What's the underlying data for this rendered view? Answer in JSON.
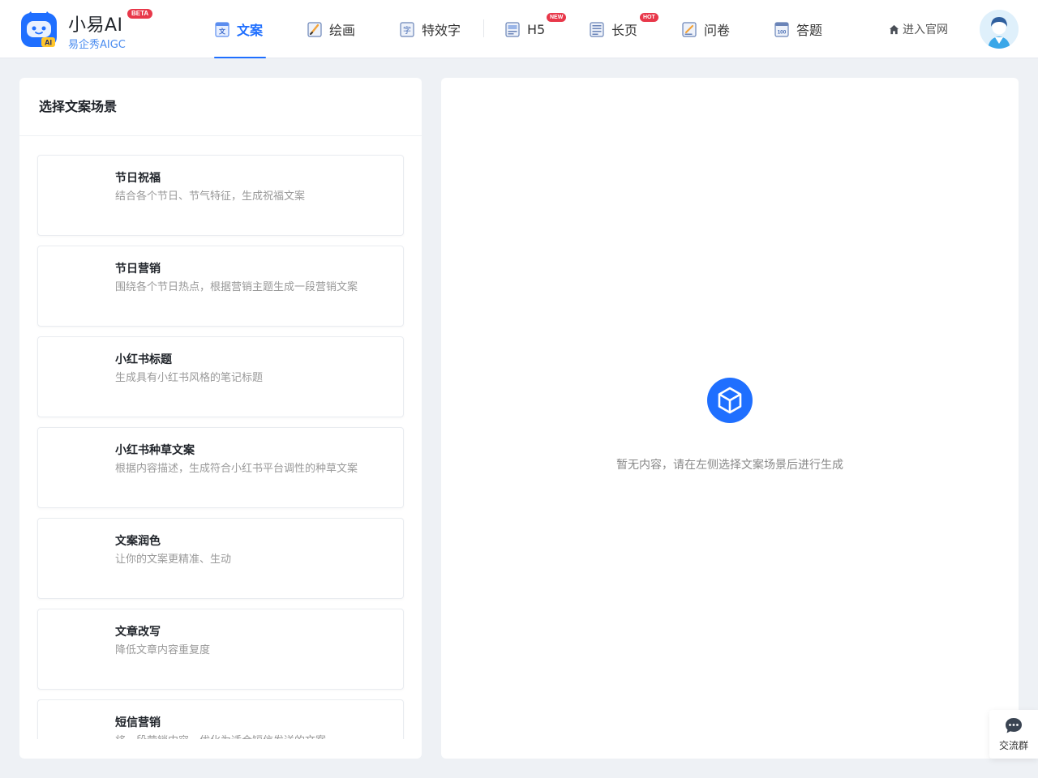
{
  "header": {
    "brand_name": "小易AI",
    "brand_badge": "BETA",
    "brand_sub": "易企秀AIGC",
    "nav": [
      {
        "label": "文案",
        "icon": "copywriting-icon",
        "active": true
      },
      {
        "label": "绘画",
        "icon": "painting-icon",
        "active": false
      },
      {
        "label": "特效字",
        "icon": "effect-text-icon",
        "active": false
      },
      {
        "label": "H5",
        "icon": "h5-icon",
        "active": false,
        "badge": "NEW"
      },
      {
        "label": "长页",
        "icon": "long-page-icon",
        "active": false,
        "badge": "HOT"
      },
      {
        "label": "问卷",
        "icon": "survey-icon",
        "active": false
      },
      {
        "label": "答题",
        "icon": "quiz-icon",
        "active": false
      }
    ],
    "official_link": "进入官网"
  },
  "left_panel": {
    "title": "选择文案场景",
    "scenes": [
      {
        "title": "节日祝福",
        "desc": "结合各个节日、节气特征，生成祝福文案"
      },
      {
        "title": "节日营销",
        "desc": "围绕各个节日热点，根据营销主题生成一段营销文案"
      },
      {
        "title": "小红书标题",
        "desc": "生成具有小红书风格的笔记标题"
      },
      {
        "title": "小红书种草文案",
        "desc": "根据内容描述，生成符合小红书平台调性的种草文案"
      },
      {
        "title": "文案润色",
        "desc": "让你的文案更精准、生动"
      },
      {
        "title": "文章改写",
        "desc": "降低文章内容重复度"
      },
      {
        "title": "短信营销",
        "desc": "将一段营销内容，优化为适合短信发送的文案"
      }
    ]
  },
  "right_panel": {
    "empty_text": "暂无内容，请在左侧选择文案场景后进行生成",
    "empty_icon": "box-icon"
  },
  "float_button": {
    "label": "交流群",
    "icon": "chat-icon"
  },
  "colors": {
    "primary": "#1f6fff",
    "badge_red": "#e8384a",
    "background": "#eef1f5"
  }
}
